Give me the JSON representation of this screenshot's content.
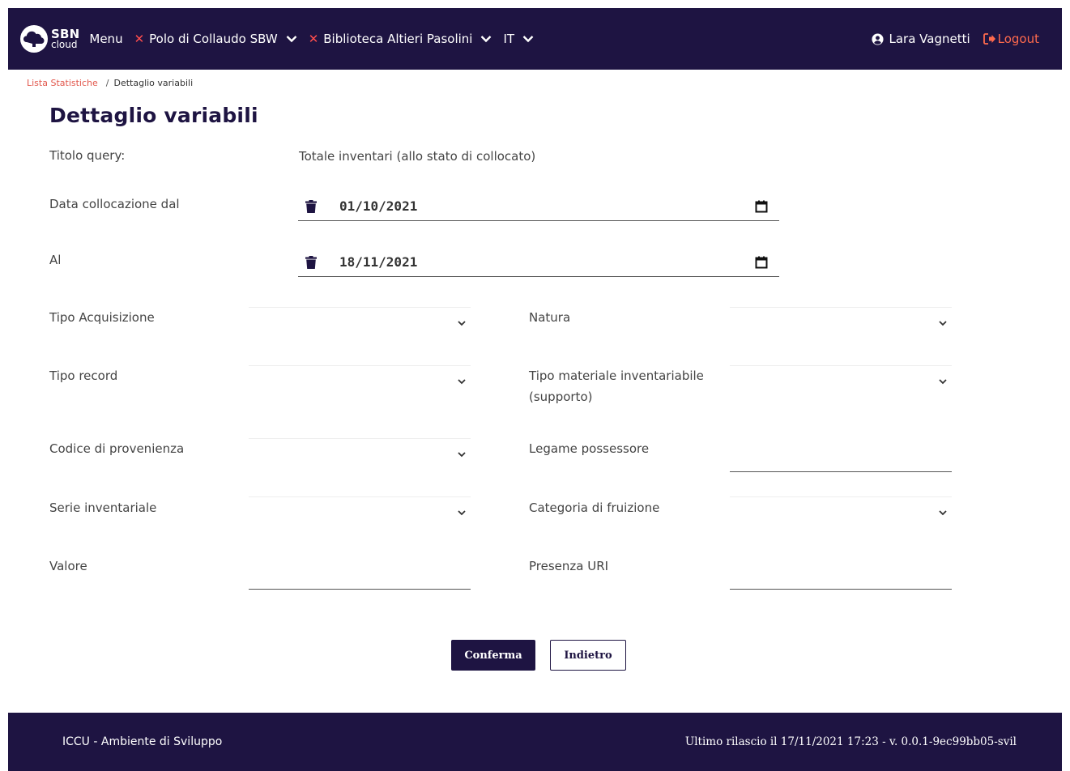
{
  "header": {
    "logo_line1": "SBN",
    "logo_line2": "cloud",
    "menu_label": "Menu",
    "polo_label": "Polo di Collaudo SBW",
    "library_label": "Biblioteca Altieri Pasolini",
    "language_label": "IT",
    "user_name": "Lara Vagnetti",
    "logout_label": "Logout"
  },
  "breadcrumb": {
    "parent": "Lista Statistiche",
    "separator": "/",
    "current": "Dettaglio variabili"
  },
  "page_title": "Dettaglio variabili",
  "form": {
    "titolo_query_label": "Titolo query:",
    "titolo_query_value": "Totale inventari (allo stato di collocato)",
    "data_dal_label": "Data collocazione dal",
    "data_dal_value": "01/10/2021",
    "data_al_label": "Al",
    "data_al_value": "18/11/2021",
    "tipo_acquisizione_label": "Tipo Acquisizione",
    "natura_label": "Natura",
    "tipo_record_label": "Tipo record",
    "tipo_materiale_label_line1": "Tipo materiale inventariabile",
    "tipo_materiale_label_line2": "(supporto)",
    "codice_provenienza_label": "Codice di provenienza",
    "legame_possessore_label": "Legame possessore",
    "serie_inventariale_label": "Serie inventariale",
    "categoria_fruizione_label": "Categoria di fruizione",
    "valore_label": "Valore",
    "presenza_uri_label": "Presenza URI"
  },
  "buttons": {
    "confirm": "Conferma",
    "back": "Indietro"
  },
  "footer": {
    "left": "ICCU - Ambiente di Sviluppo",
    "right": "Ultimo rilascio il 17/11/2021 17:23 - v. 0.0.1-9ec99bb05-svil"
  },
  "colors": {
    "brand_dark": "#1e1442",
    "accent_red": "#e2574c",
    "logout_orange": "#ff6a4d"
  },
  "icons": {
    "logo": "cloud-icon",
    "close": "x-icon",
    "dropdown": "chevron-down-icon",
    "user": "user-circle-icon",
    "logout": "logout-icon",
    "delete": "trash-icon",
    "calendar": "calendar-icon"
  }
}
